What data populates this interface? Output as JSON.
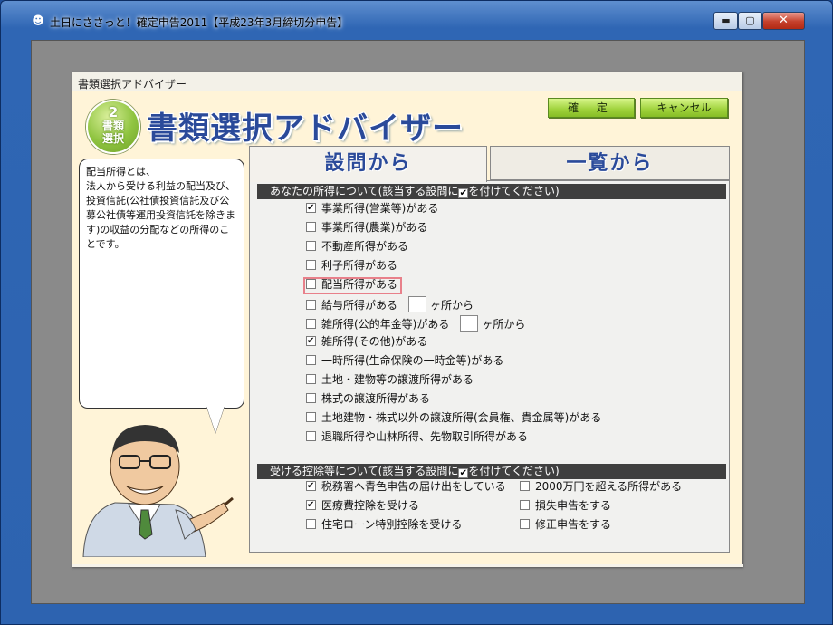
{
  "window": {
    "title": "土日にささっと！確定申告2011【平成23年3月締切分申告】",
    "app_icon": "app-icon",
    "controls": {
      "minimize": "▬",
      "maximize": "▢",
      "close": "✕"
    }
  },
  "dialog": {
    "title": "書類選択アドバイザー",
    "heading": "書類選択アドバイザー",
    "logo": {
      "number": "2",
      "text": "書類選択"
    },
    "ok_label": "確 定",
    "cancel_label": "キャンセル",
    "bubble_text": "配当所得とは、\n法人から受ける利益の配当及び、投資信託(公社債投資信託及び公募公社債等運用投資信託を除きます)の収益の分配などの所得のことです。",
    "tabs": {
      "questions": "設問から",
      "list": "一覧から"
    }
  },
  "income_section": {
    "header_pre": "あなたの所得について(該当する設問に",
    "header_post": "を付けてください)",
    "items": [
      {
        "label": "事業所得(営業等)がある",
        "checked": true
      },
      {
        "label": "事業所得(農業)がある",
        "checked": false
      },
      {
        "label": "不動産所得がある",
        "checked": false
      },
      {
        "label": "利子所得がある",
        "checked": false
      },
      {
        "label": "配当所得がある",
        "checked": false
      },
      {
        "label": "給与所得がある",
        "checked": false,
        "count_suffix": "ヶ所から"
      },
      {
        "label": "雑所得(公的年金等)がある",
        "checked": false,
        "count_suffix": "ヶ所から"
      },
      {
        "label": "雑所得(その他)がある",
        "checked": true
      },
      {
        "label": "一時所得(生命保険の一時金等)がある",
        "checked": false
      },
      {
        "label": "土地・建物等の譲渡所得がある",
        "checked": false
      },
      {
        "label": "株式の譲渡所得がある",
        "checked": false
      },
      {
        "label": "土地建物・株式以外の譲渡所得(会員権、貴金属等)がある",
        "checked": false
      },
      {
        "label": "退職所得や山林所得、先物取引所得がある",
        "checked": false
      }
    ]
  },
  "deduction_section": {
    "header_pre": "受ける控除等について(該当する設問に",
    "header_post": "を付けてください)",
    "left_items": [
      {
        "label": "税務署へ青色申告の届け出をしている",
        "checked": true
      },
      {
        "label": "医療費控除を受ける",
        "checked": true
      },
      {
        "label": "住宅ローン特別控除を受ける",
        "checked": false
      }
    ],
    "right_items": [
      {
        "label": "2000万円を超える所得がある",
        "checked": false
      },
      {
        "label": "損失申告をする",
        "checked": false
      },
      {
        "label": "修正申告をする",
        "checked": false
      }
    ]
  }
}
